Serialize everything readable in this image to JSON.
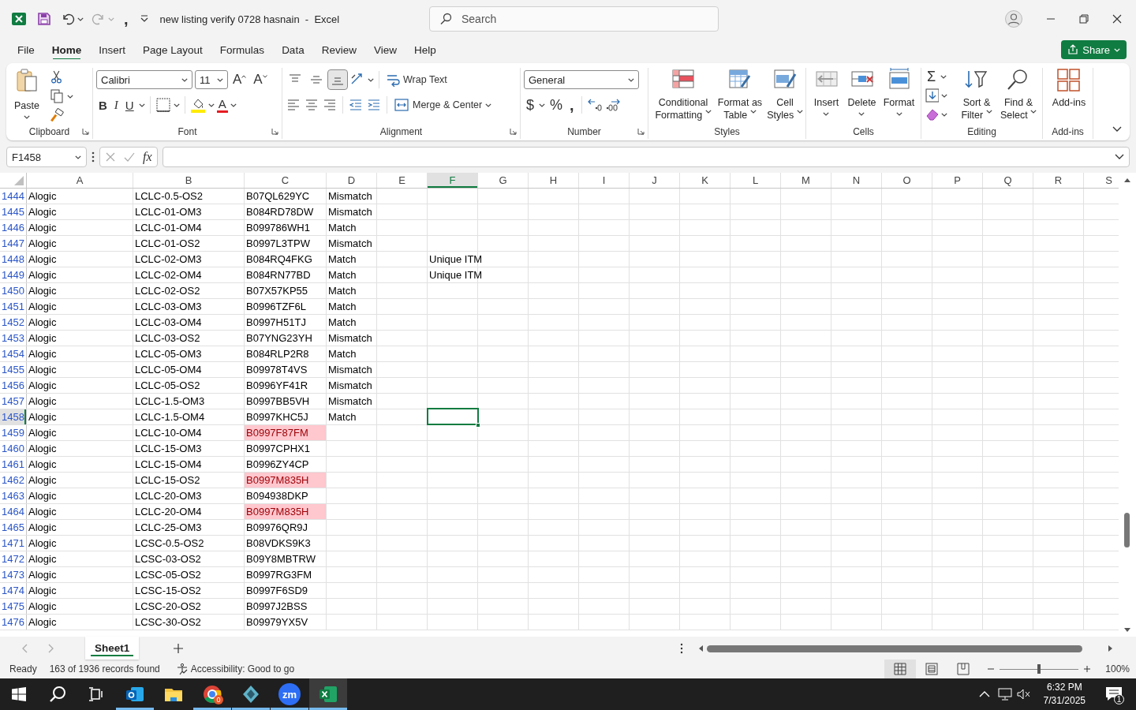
{
  "title_bar": {
    "quick_access_comma": ",",
    "title": "new listing verify 0728 hasnain  -  Excel"
  },
  "search": {
    "placeholder": "Search"
  },
  "menu_tabs": [
    {
      "label": "File",
      "selected": false
    },
    {
      "label": "Home",
      "selected": true
    },
    {
      "label": "Insert",
      "selected": false
    },
    {
      "label": "Page Layout",
      "selected": false
    },
    {
      "label": "Formulas",
      "selected": false
    },
    {
      "label": "Data",
      "selected": false
    },
    {
      "label": "Review",
      "selected": false
    },
    {
      "label": "View",
      "selected": false
    },
    {
      "label": "Help",
      "selected": false
    }
  ],
  "share_button": "Share",
  "ribbon": [
    {
      "kind": "clipboard",
      "label": "Clipboard",
      "paste_label": "Paste"
    },
    {
      "kind": "font",
      "label": "Font",
      "font_name": "Calibri",
      "font_size": "11",
      "grow_label": "A",
      "shrink_label": "A",
      "style_buttons": [
        {
          "kind": "bold",
          "label": "B"
        },
        {
          "kind": "italic",
          "label": "I"
        },
        {
          "kind": "underline",
          "label": "U"
        }
      ],
      "font_color_label": "A"
    },
    {
      "kind": "alignment",
      "label": "Alignment",
      "vertical_align": [
        {
          "selected": false
        },
        {
          "selected": false
        },
        {
          "selected": true
        }
      ],
      "wrap_label": "Wrap Text",
      "merge_label": "Merge & Center"
    },
    {
      "kind": "number",
      "label": "Number",
      "format": "General",
      "currency_label": "$",
      "percent_label": "%",
      "comma_label": ","
    },
    {
      "kind": "styles",
      "label": "Styles",
      "buttons": [
        {
          "kind": "conditional",
          "label": "Conditional Formatting"
        },
        {
          "kind": "table",
          "label": "Format as Table"
        },
        {
          "kind": "cell_styles",
          "label": "Cell Styles"
        }
      ]
    },
    {
      "kind": "cells",
      "label": "Cells",
      "buttons": [
        {
          "kind": "insert",
          "label": "Insert"
        },
        {
          "kind": "delete",
          "label": "Delete"
        },
        {
          "kind": "format",
          "label": "Format"
        }
      ]
    },
    {
      "kind": "editing",
      "label": "Editing",
      "autosum_label": "Σ",
      "buttons": [
        {
          "kind": "sort",
          "label": "Sort & Filter"
        },
        {
          "kind": "find",
          "label": "Find & Select"
        }
      ]
    },
    {
      "kind": "addins",
      "label": "Add-ins",
      "buttons": [
        {
          "kind": "addins",
          "label": "Add-ins"
        }
      ]
    }
  ],
  "formula_bar": {
    "name_box": "F1458",
    "function_label": "fx"
  },
  "columns": [
    {
      "label": "A",
      "selected": false
    },
    {
      "label": "B",
      "selected": false
    },
    {
      "label": "C",
      "selected": false
    },
    {
      "label": "D",
      "selected": false
    },
    {
      "label": "E",
      "selected": false
    },
    {
      "label": "F",
      "selected": true
    },
    {
      "label": "G",
      "selected": false
    },
    {
      "label": "H",
      "selected": false
    },
    {
      "label": "I",
      "selected": false
    },
    {
      "label": "J",
      "selected": false
    },
    {
      "label": "K",
      "selected": false
    },
    {
      "label": "L",
      "selected": false
    },
    {
      "label": "M",
      "selected": false
    },
    {
      "label": "N",
      "selected": false
    },
    {
      "label": "O",
      "selected": false
    },
    {
      "label": "P",
      "selected": false
    },
    {
      "label": "Q",
      "selected": false
    },
    {
      "label": "R",
      "selected": false
    },
    {
      "label": "S",
      "selected": false
    }
  ],
  "rows": [
    {
      "number": "1444",
      "cells": {
        "A": "Alogic",
        "B": "LCLC-0.5-OS2",
        "C": "B07QL629YC",
        "D": "Mismatch"
      },
      "duplicate": false,
      "selected": false
    },
    {
      "number": "1445",
      "cells": {
        "A": "Alogic",
        "B": "LCLC-01-OM3",
        "C": "B084RD78DW",
        "D": "Mismatch"
      },
      "duplicate": false,
      "selected": false
    },
    {
      "number": "1446",
      "cells": {
        "A": "Alogic",
        "B": "LCLC-01-OM4",
        "C": "B099786WH1",
        "D": "Match"
      },
      "duplicate": false,
      "selected": false
    },
    {
      "number": "1447",
      "cells": {
        "A": "Alogic",
        "B": "LCLC-01-OS2",
        "C": "B0997L3TPW",
        "D": "Mismatch"
      },
      "duplicate": false,
      "selected": false
    },
    {
      "number": "1448",
      "cells": {
        "A": "Alogic",
        "B": "LCLC-02-OM3",
        "C": "B084RQ4FKG",
        "D": "Match",
        "F": "Unique ITM"
      },
      "duplicate": false,
      "selected": false
    },
    {
      "number": "1449",
      "cells": {
        "A": "Alogic",
        "B": "LCLC-02-OM4",
        "C": "B084RN77BD",
        "D": "Match",
        "F": "Unique ITM"
      },
      "duplicate": false,
      "selected": false
    },
    {
      "number": "1450",
      "cells": {
        "A": "Alogic",
        "B": "LCLC-02-OS2",
        "C": "B07X57KP55",
        "D": "Match"
      },
      "duplicate": false,
      "selected": false
    },
    {
      "number": "1451",
      "cells": {
        "A": "Alogic",
        "B": "LCLC-03-OM3",
        "C": "B0996TZF6L",
        "D": "Match"
      },
      "duplicate": false,
      "selected": false
    },
    {
      "number": "1452",
      "cells": {
        "A": "Alogic",
        "B": "LCLC-03-OM4",
        "C": "B0997H51TJ",
        "D": "Match"
      },
      "duplicate": false,
      "selected": false
    },
    {
      "number": "1453",
      "cells": {
        "A": "Alogic",
        "B": "LCLC-03-OS2",
        "C": "B07YNG23YH",
        "D": "Mismatch"
      },
      "duplicate": false,
      "selected": false
    },
    {
      "number": "1454",
      "cells": {
        "A": "Alogic",
        "B": "LCLC-05-OM3",
        "C": "B084RLP2R8",
        "D": "Match"
      },
      "duplicate": false,
      "selected": false
    },
    {
      "number": "1455",
      "cells": {
        "A": "Alogic",
        "B": "LCLC-05-OM4",
        "C": "B09978T4VS",
        "D": "Mismatch"
      },
      "duplicate": false,
      "selected": false
    },
    {
      "number": "1456",
      "cells": {
        "A": "Alogic",
        "B": "LCLC-05-OS2",
        "C": "B0996YF41R",
        "D": "Mismatch"
      },
      "duplicate": false,
      "selected": false
    },
    {
      "number": "1457",
      "cells": {
        "A": "Alogic",
        "B": "LCLC-1.5-OM3",
        "C": "B0997BB5VH",
        "D": "Mismatch"
      },
      "duplicate": false,
      "selected": false
    },
    {
      "number": "1458",
      "cells": {
        "A": "Alogic",
        "B": "LCLC-1.5-OM4",
        "C": "B0997KHC5J",
        "D": "Match"
      },
      "duplicate": false,
      "selected": true
    },
    {
      "number": "1459",
      "cells": {
        "A": "Alogic",
        "B": "LCLC-10-OM4",
        "C": "B0997F87FM"
      },
      "duplicate": true,
      "selected": false
    },
    {
      "number": "1460",
      "cells": {
        "A": "Alogic",
        "B": "LCLC-15-OM3",
        "C": "B0997CPHX1"
      },
      "duplicate": false,
      "selected": false
    },
    {
      "number": "1461",
      "cells": {
        "A": "Alogic",
        "B": "LCLC-15-OM4",
        "C": "B0996ZY4CP"
      },
      "duplicate": false,
      "selected": false
    },
    {
      "number": "1462",
      "cells": {
        "A": "Alogic",
        "B": "LCLC-15-OS2",
        "C": "B0997M835H"
      },
      "duplicate": true,
      "selected": false
    },
    {
      "number": "1463",
      "cells": {
        "A": "Alogic",
        "B": "LCLC-20-OM3",
        "C": "B094938DKP"
      },
      "duplicate": false,
      "selected": false
    },
    {
      "number": "1464",
      "cells": {
        "A": "Alogic",
        "B": "LCLC-20-OM4",
        "C": "B0997M835H"
      },
      "duplicate": true,
      "selected": false
    },
    {
      "number": "1465",
      "cells": {
        "A": "Alogic",
        "B": "LCLC-25-OM3",
        "C": "B09976QR9J"
      },
      "duplicate": false,
      "selected": false
    },
    {
      "number": "1471",
      "cells": {
        "A": "Alogic",
        "B": "LCSC-0.5-OS2",
        "C": "B08VDKS9K3"
      },
      "duplicate": false,
      "selected": false
    },
    {
      "number": "1472",
      "cells": {
        "A": "Alogic",
        "B": "LCSC-03-OS2",
        "C": "B09Y8MBTRW"
      },
      "duplicate": false,
      "selected": false
    },
    {
      "number": "1473",
      "cells": {
        "A": "Alogic",
        "B": "LCSC-05-OS2",
        "C": "B0997RG3FM"
      },
      "duplicate": false,
      "selected": false
    },
    {
      "number": "1474",
      "cells": {
        "A": "Alogic",
        "B": "LCSC-15-OS2",
        "C": "B0997F6SD9"
      },
      "duplicate": false,
      "selected": false
    },
    {
      "number": "1475",
      "cells": {
        "A": "Alogic",
        "B": "LCSC-20-OS2",
        "C": "B0997J2BSS"
      },
      "duplicate": false,
      "selected": false
    },
    {
      "number": "1476",
      "cells": {
        "A": "Alogic",
        "B": "LCSC-30-OS2",
        "C": "B09979YX5V"
      },
      "duplicate": false,
      "selected": false
    }
  ],
  "sheet_tabs": [
    {
      "label": "Sheet1",
      "selected": true
    }
  ],
  "status_bar": {
    "mode": "Ready",
    "records": "163 of 1936 records found",
    "accessibility": "Accessibility: Good to go",
    "views": [
      {
        "selected": true
      },
      {
        "selected": false
      },
      {
        "selected": false
      }
    ],
    "zoom": {
      "level": 0.5,
      "label": "100%"
    }
  },
  "taskbar": {
    "apps": [
      {
        "kind": "outlook",
        "running": true,
        "active": false
      },
      {
        "kind": "explorer",
        "running": false,
        "active": false
      },
      {
        "kind": "chrome",
        "running": true,
        "active": false,
        "badge": "0"
      },
      {
        "kind": "diamond",
        "running": true,
        "active": false
      },
      {
        "kind": "zoom",
        "running": true,
        "active": false,
        "logo_text": "zm"
      },
      {
        "kind": "excel",
        "running": true,
        "active": true
      }
    ],
    "time": "6:32 PM",
    "date": "7/31/2025",
    "notification_count": "1"
  }
}
